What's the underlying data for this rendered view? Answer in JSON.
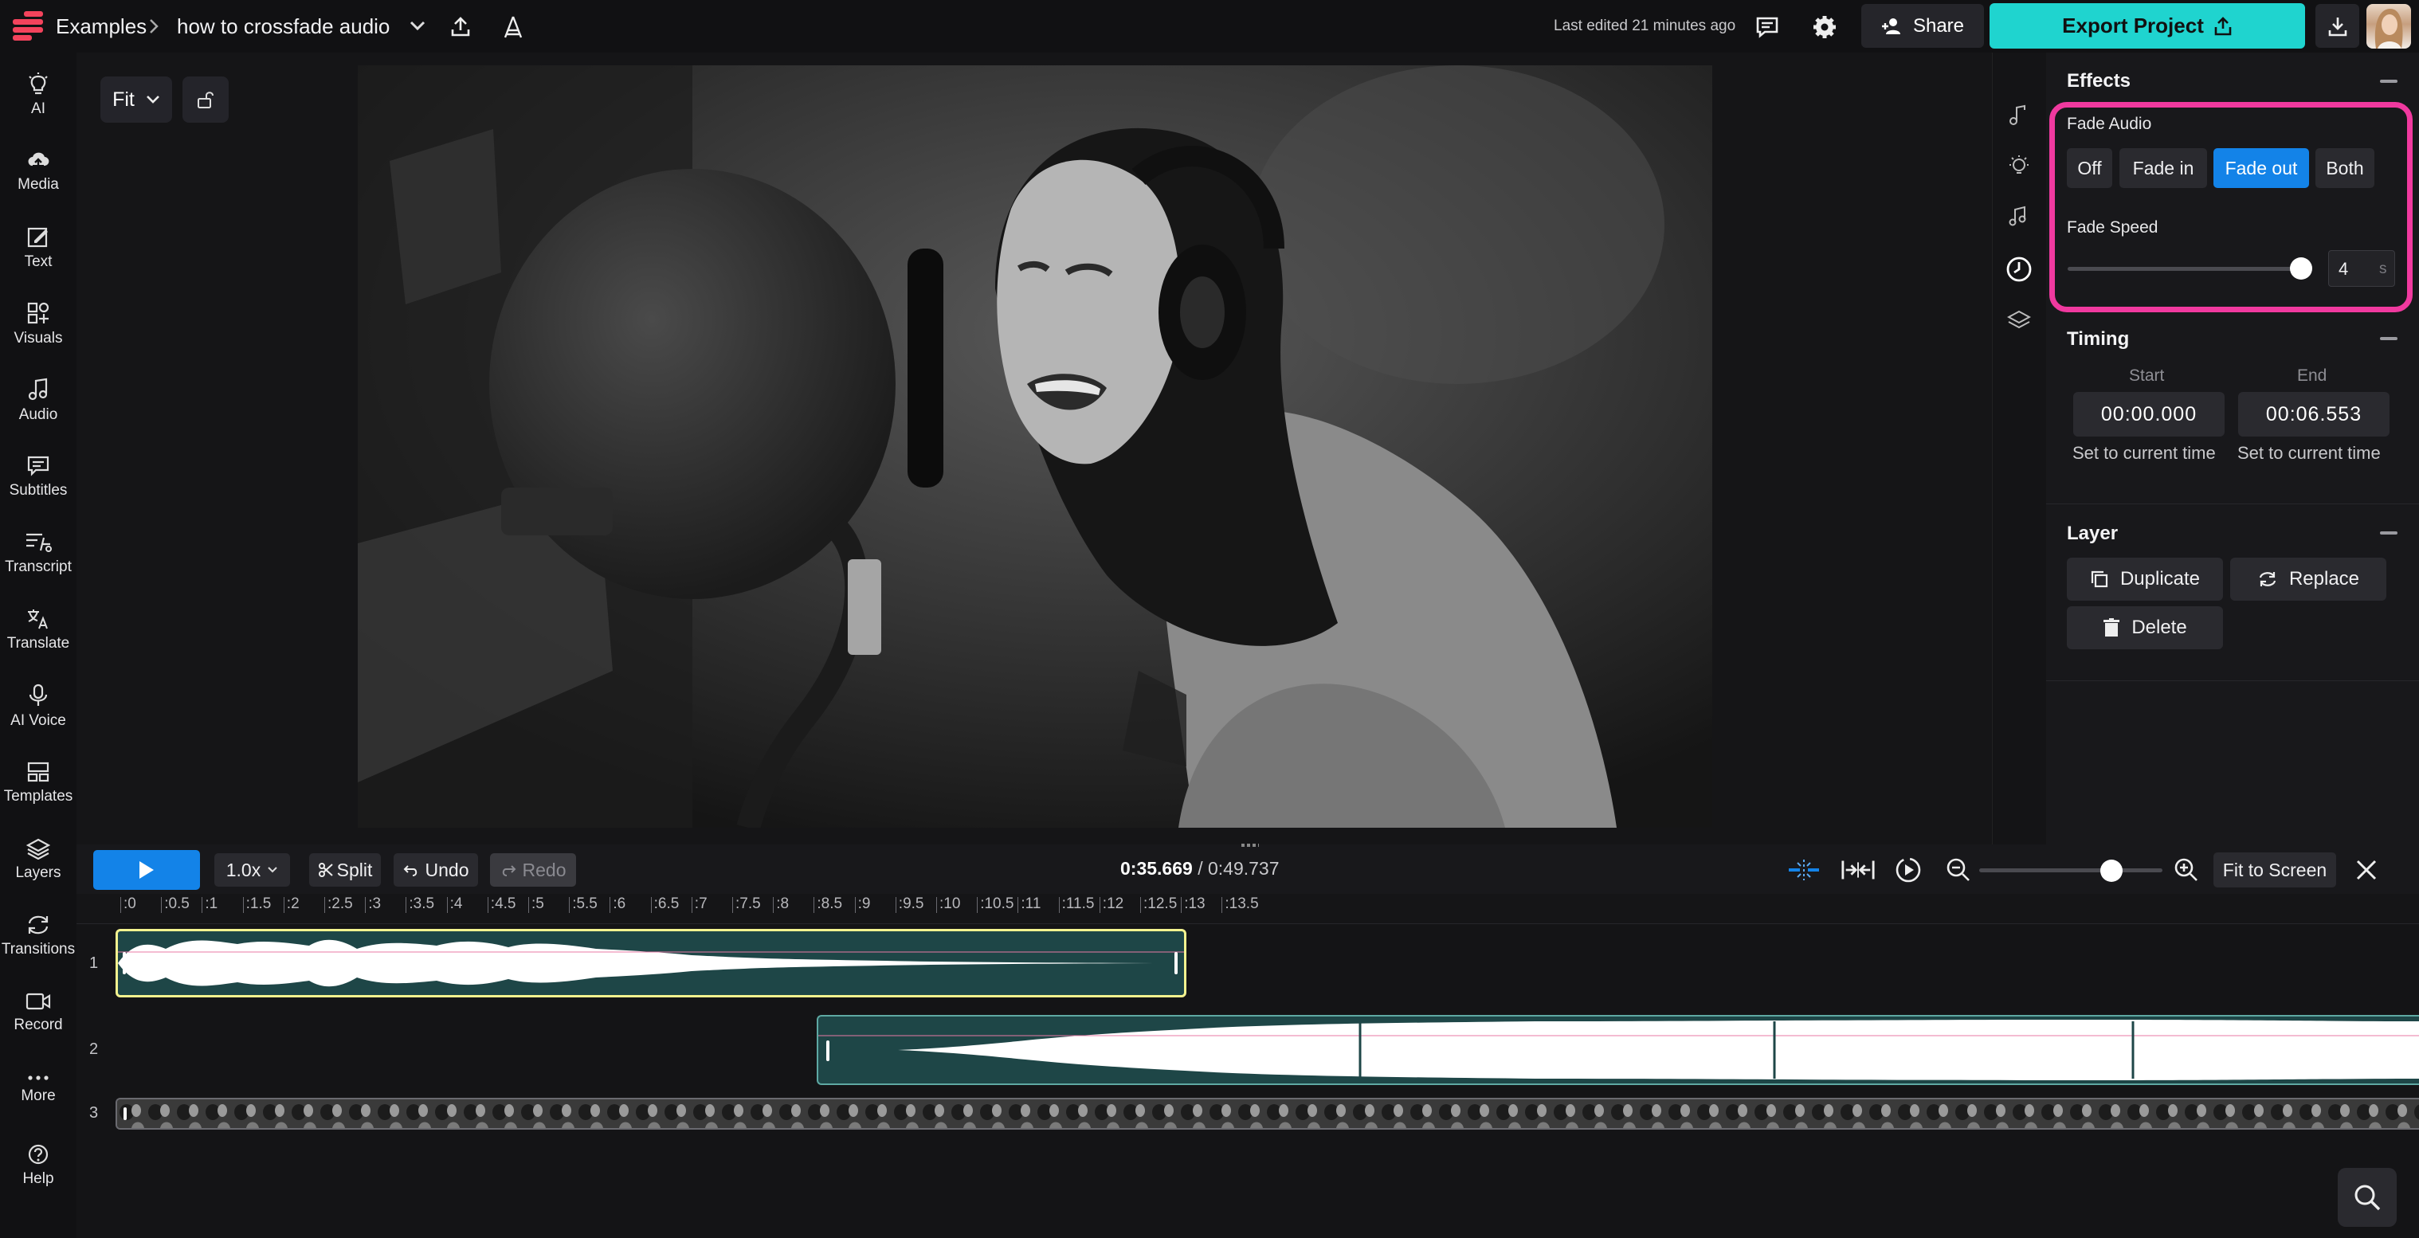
{
  "colors": {
    "accent_teal": "#1fd4cf",
    "active_blue": "#1383e8",
    "highlight_pink": "#f0399f",
    "clip_selected_border": "#f3f38f",
    "clip_fill": "#1e4647"
  },
  "header": {
    "breadcrumb_parent": "Examples",
    "project_name": "how to crossfade audio",
    "last_edited": "Last edited 21 minutes ago",
    "share_label": "Share",
    "export_label": "Export Project"
  },
  "sidebar": {
    "items": [
      {
        "label": "AI",
        "icon": "lightbulb-icon"
      },
      {
        "label": "Media",
        "icon": "upload-cloud-icon"
      },
      {
        "label": "Text",
        "icon": "text-edit-icon"
      },
      {
        "label": "Visuals",
        "icon": "shapes-icon"
      },
      {
        "label": "Audio",
        "icon": "music-note-icon"
      },
      {
        "label": "Subtitles",
        "icon": "subtitles-icon"
      },
      {
        "label": "Transcript",
        "icon": "transcript-icon"
      },
      {
        "label": "Translate",
        "icon": "translate-icon"
      },
      {
        "label": "AI Voice",
        "icon": "ai-voice-icon"
      },
      {
        "label": "Templates",
        "icon": "templates-icon"
      },
      {
        "label": "Layers",
        "icon": "layers-icon"
      },
      {
        "label": "Transitions",
        "icon": "transitions-icon"
      },
      {
        "label": "Record",
        "icon": "record-icon"
      },
      {
        "label": "More",
        "icon": "more-dots-icon"
      },
      {
        "label": "Help",
        "icon": "help-icon"
      }
    ]
  },
  "canvas": {
    "fit_label": "Fit"
  },
  "panel": {
    "effects": {
      "title": "Effects",
      "fade_audio_label": "Fade Audio",
      "fade_options": [
        "Off",
        "Fade in",
        "Fade out",
        "Both"
      ],
      "fade_selected": "Fade out",
      "fade_speed_label": "Fade Speed",
      "fade_speed_value": "4",
      "fade_speed_unit": "s",
      "fade_speed_fraction": 0.96
    },
    "timing": {
      "title": "Timing",
      "start_label": "Start",
      "end_label": "End",
      "start_value": "00:00.000",
      "end_value": "00:06.553",
      "set_current_label": "Set to current time"
    },
    "layer": {
      "title": "Layer",
      "duplicate_label": "Duplicate",
      "replace_label": "Replace",
      "delete_label": "Delete"
    }
  },
  "timeline": {
    "speed_label": "1.0x",
    "split_label": "Split",
    "undo_label": "Undo",
    "redo_label": "Redo",
    "current_time": "0:35.669",
    "total_time": "0:49.737",
    "fit_to_screen_label": "Fit to Screen",
    "zoom_fraction": 0.72,
    "ruler_ticks": [
      ":0",
      ":0.5",
      ":1",
      ":1.5",
      ":2",
      ":2.5",
      ":3",
      ":3.5",
      ":4",
      ":4.5",
      ":5",
      ":5.5",
      ":6",
      ":6.5",
      ":7",
      ":7.5",
      ":8",
      ":8.5",
      ":9",
      ":9.5",
      ":10",
      ":10.5",
      ":11",
      ":11.5",
      ":12",
      ":12.5",
      ":13",
      ":13.5"
    ],
    "track_numbers": [
      "1",
      "2",
      "3"
    ]
  }
}
